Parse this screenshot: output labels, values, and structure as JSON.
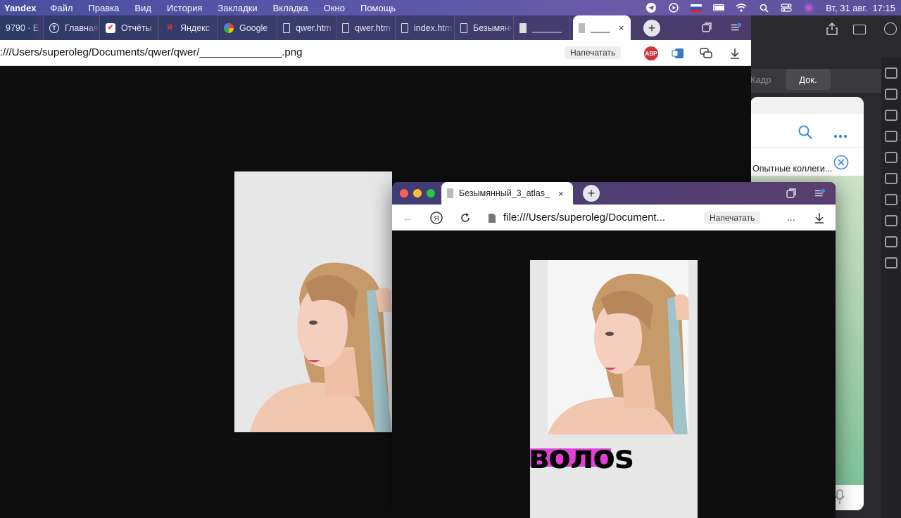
{
  "colors": {
    "accent_magenta": "#e23fd6",
    "abp_red": "#d62f3a",
    "menubar": "#5a56a8"
  },
  "menubar": {
    "app": "Yandex",
    "items": [
      "Файл",
      "Правка",
      "Вид",
      "История",
      "Закладки",
      "Вкладка",
      "Окно",
      "Помощь"
    ],
    "datetime": "Вт, 31 авг.  17:15",
    "icons": [
      "telegram-icon",
      "play-icon",
      "russian-flag-icon",
      "battery-icon",
      "wifi-icon",
      "search-icon",
      "control-center-icon",
      "siri-icon"
    ]
  },
  "main": {
    "tabs": [
      {
        "label": "9790 · E",
        "icon": "tab-favicon"
      },
      {
        "label": "Главная",
        "icon": "t-logo-icon"
      },
      {
        "label": "Отчёты",
        "icon": "checkbox-logo-icon"
      },
      {
        "label": "Яндекс",
        "icon": "yandex-icon"
      },
      {
        "label": "Google",
        "icon": "google-icon"
      },
      {
        "label": "qwer.htm",
        "icon": "file-icon"
      },
      {
        "label": "qwer.htm",
        "icon": "file-icon"
      },
      {
        "label": "index.htm",
        "icon": "file-icon"
      },
      {
        "label": "Безымянный",
        "icon": "file-icon"
      },
      {
        "label": "______",
        "icon": "image-file-icon"
      }
    ],
    "active_tab": {
      "label": "____",
      "close": "×"
    },
    "new_tab": "+",
    "url": ":///Users/superoleg/Documents/qwer/qwer/______________.png",
    "print": "Напечатать",
    "ext_abp": "ABP"
  },
  "win2": {
    "active_tab": {
      "label": "Безымянный_3_atlas_",
      "close": "×"
    },
    "new_tab": "+",
    "url": "file:///Users/superoleg/Document...",
    "print": "Напечатать",
    "more": "...",
    "logo_text": "волоs"
  },
  "right_app": {
    "tab_kadr": "Кадр",
    "tab_dok": "Док.",
    "chat_title": "Опытные коллеги..."
  }
}
